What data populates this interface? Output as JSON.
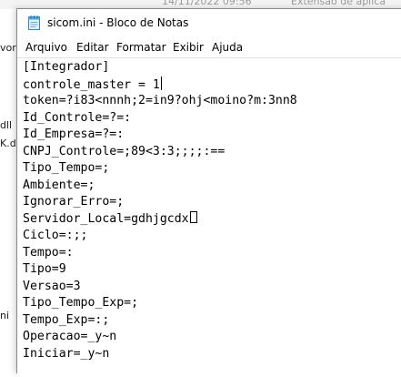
{
  "background": {
    "date": "14/11/2022 09:56",
    "type": "Extensão de aplica",
    "left_labels": [
      "vork",
      "dll",
      "K.dll",
      "ni"
    ]
  },
  "window": {
    "title": "sicom.ini - Bloco de Notas",
    "icon": "notepad-icon"
  },
  "menu": {
    "arquivo": "Arquivo",
    "editar": "Editar",
    "formatar": "Formatar",
    "exibir": "Exibir",
    "ajuda": "Ajuda"
  },
  "editor": {
    "lines": [
      "[Integrador]",
      "controle_master = 1",
      "token=?i83<nnnh;2=in9?ohj<moino?m:3nn8",
      "Id_Controle=?=:",
      "Id_Empresa=?=:",
      "CNPJ_Controle=;89<3:3;;;;:==",
      "Tipo_Tempo=;",
      "Ambiente=;",
      "Ignorar_Erro=;",
      "Servidor_Local=gdhjgcdx",
      "Ciclo=:;;",
      "Tempo=:",
      "Tipo=9",
      "Versao=3",
      "Tipo_Tempo_Exp=;",
      "Tempo_Exp=:;",
      "Operacao=_y~n",
      "Iniciar=_y~n"
    ]
  }
}
